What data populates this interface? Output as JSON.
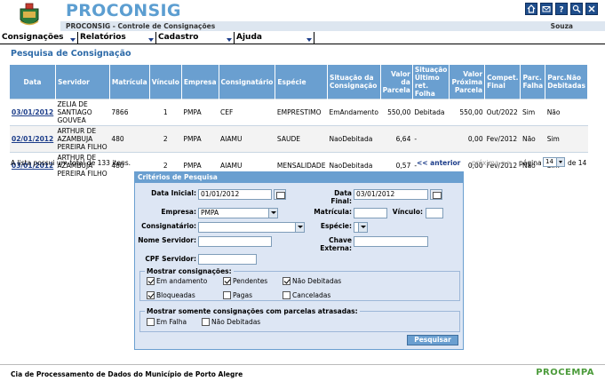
{
  "app": {
    "title": "PROCONSIG",
    "subtitle": "PROCONSIG - Controle de Consignações",
    "user": "Souza"
  },
  "toolbar_icons": [
    "home-icon",
    "mail-icon",
    "help-icon",
    "search-icon",
    "close-icon"
  ],
  "menu": [
    {
      "label": "Consignações"
    },
    {
      "label": "Relatórios"
    },
    {
      "label": "Cadastro"
    },
    {
      "label": "Ajuda"
    }
  ],
  "page_title": "Pesquisa de Consignação",
  "table": {
    "headers": [
      "Data",
      "Servidor",
      "Matrícula",
      "Vínculo",
      "Empresa",
      "Consignatário",
      "Espécie",
      "Situação da Consignação",
      "Valor da Parcela",
      "Situação Último ret. Folha",
      "Valor Próxima Parcela",
      "Compet. Final",
      "Parc. Falha",
      "Parc.Não Debitadas"
    ],
    "rows": [
      [
        "03/01/2012",
        "ZELIA DE SANTIAGO GOUVEA",
        "7866",
        "1",
        "PMPA",
        "CEF",
        "EMPRESTIMO",
        "EmAndamento",
        "550,00",
        "Debitada",
        "550,00",
        "Out/2022",
        "Sim",
        "Não"
      ],
      [
        "02/01/2012",
        "ARTHUR DE AZAMBUJA PEREIRA FILHO",
        "480",
        "2",
        "PMPA",
        "AIAMU",
        "SAUDE",
        "NaoDebitada",
        "6,64",
        "-",
        "0,00",
        "Fev/2012",
        "Não",
        "Sim"
      ],
      [
        "03/01/2012",
        "ARTHUR DE AZAMBUJA PEREIRA FILHO",
        "480",
        "2",
        "PMPA",
        "AIAMU",
        "MENSALIDADE",
        "NaoDebitada",
        "0,57",
        "-",
        "0,00",
        "Fev/2012",
        "Não",
        "Sim"
      ]
    ]
  },
  "pagination": {
    "total_text": "A lista possui um total de 133 itens.",
    "prev": "<< anterior",
    "next": "próxima >>",
    "page_label": "página",
    "current_page": "14",
    "of_text": "de 14"
  },
  "criteria": {
    "title": "Critérios de Pesquisa",
    "data_inicial_label": "Data Inicial:",
    "data_inicial": "01/01/2012",
    "data_final_label": "Data Final:",
    "data_final": "03/01/2012",
    "empresa_label": "Empresa:",
    "empresa": "PMPA",
    "matricula_label": "Matrícula:",
    "matricula": "",
    "vinculo_label": "Vínculo:",
    "vinculo": "",
    "consignatario_label": "Consignatário:",
    "consignatario": "",
    "especie_label": "Espécie:",
    "especie": "",
    "nome_servidor_label": "Nome Servidor:",
    "nome_servidor": "",
    "chave_externa_label": "Chave Externa:",
    "chave_externa": "",
    "cpf_label": "CPF Servidor:",
    "cpf": "",
    "mostrar_label": "Mostrar consignações:",
    "mostrar_options": [
      {
        "label": "Em andamento",
        "checked": true
      },
      {
        "label": "Pendentes",
        "checked": true
      },
      {
        "label": "Não Debitadas",
        "checked": true
      },
      {
        "label": "Bloqueadas",
        "checked": true
      },
      {
        "label": "Pagas",
        "checked": false
      },
      {
        "label": "Canceladas",
        "checked": false
      }
    ],
    "atrasadas_label": "Mostrar somente consignações com parcelas atrasadas:",
    "atrasadas_options": [
      {
        "label": "Em Falha",
        "checked": false
      },
      {
        "label": "Não Debitadas",
        "checked": false
      }
    ],
    "search_button": "Pesquisar"
  },
  "footer": {
    "text": "Cia de Processamento de Dados do Município de Porto Alegre",
    "logo_text": "PROCEMPA"
  },
  "colors": {
    "brand_blue": "#5c9ed1",
    "header_blue": "#6a9fd0",
    "link_blue": "#1c3d8a",
    "panel_bg": "#dde6f4"
  }
}
